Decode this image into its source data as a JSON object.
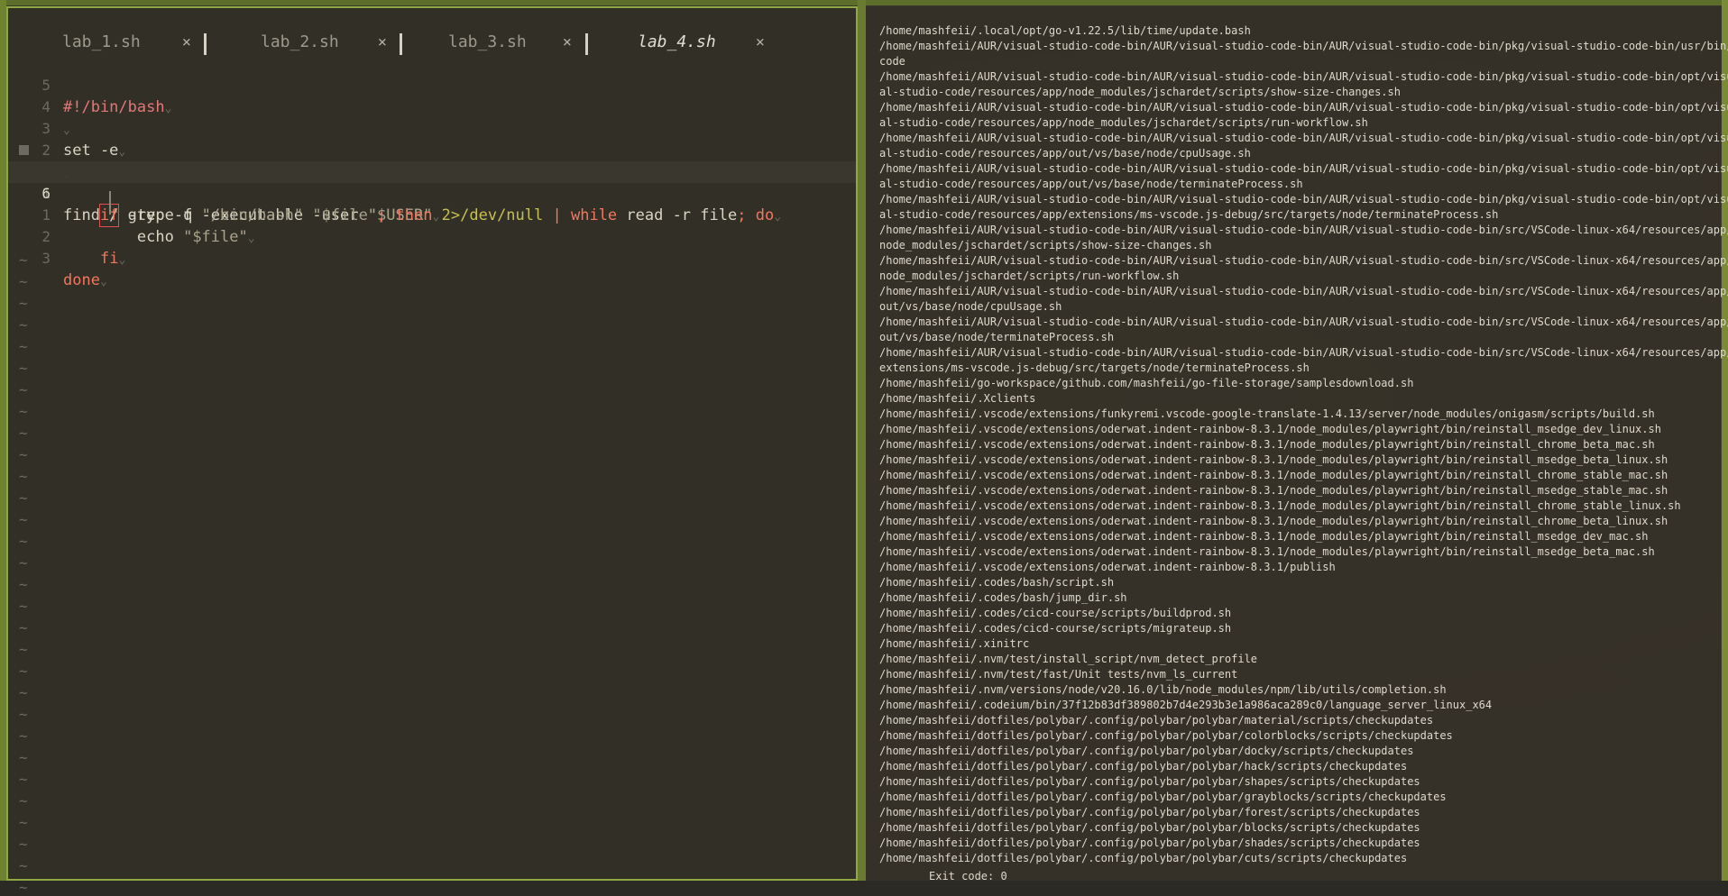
{
  "editor": {
    "tabs": [
      {
        "name": "lab_1.sh",
        "close": "×",
        "active": false
      },
      {
        "name": "lab_2.sh",
        "close": "×",
        "active": false
      },
      {
        "name": "lab_3.sh",
        "close": "×",
        "active": false
      },
      {
        "name": "lab_4.sh",
        "close": "×",
        "active": true
      }
    ],
    "lines": [
      {
        "num": "5",
        "text": "#!/bin/bash"
      },
      {
        "num": "4",
        "text": ""
      },
      {
        "num": "3",
        "text": "set -e"
      },
      {
        "num": "2",
        "text": ""
      },
      {
        "num": "1",
        "text_a": "find / -type f -executable -user ",
        "text_b": "\"$USER\"",
        "text_c": " 2>/dev/null ",
        "text_d": "|",
        "text_e": " while",
        "text_f": " read -r file",
        "text_g": ";",
        "text_h": " do"
      },
      {
        "num": "6",
        "text_a": "if",
        "text_b": " grep -q ",
        "text_c": "\"/bin/bash\"",
        "text_d": " \"$file\"",
        "text_e": ";",
        "text_f": " then"
      },
      {
        "num": "1",
        "text_a": "echo ",
        "text_b": "\"$file\""
      },
      {
        "num": "2",
        "text": "fi"
      },
      {
        "num": "3",
        "text": "done"
      }
    ],
    "tilde": "~",
    "eol_marker": "⌄"
  },
  "terminal": {
    "output": [
      "/home/mashfeii/.local/opt/go-v1.22.5/lib/time/update.bash",
      "/home/mashfeii/AUR/visual-studio-code-bin/AUR/visual-studio-code-bin/AUR/visual-studio-code-bin/pkg/visual-studio-code-bin/usr/bin/",
      "code",
      "/home/mashfeii/AUR/visual-studio-code-bin/AUR/visual-studio-code-bin/AUR/visual-studio-code-bin/pkg/visual-studio-code-bin/opt/visu",
      "al-studio-code/resources/app/node_modules/jschardet/scripts/show-size-changes.sh",
      "/home/mashfeii/AUR/visual-studio-code-bin/AUR/visual-studio-code-bin/AUR/visual-studio-code-bin/pkg/visual-studio-code-bin/opt/visu",
      "al-studio-code/resources/app/node_modules/jschardet/scripts/run-workflow.sh",
      "/home/mashfeii/AUR/visual-studio-code-bin/AUR/visual-studio-code-bin/AUR/visual-studio-code-bin/pkg/visual-studio-code-bin/opt/visu",
      "al-studio-code/resources/app/out/vs/base/node/cpuUsage.sh",
      "/home/mashfeii/AUR/visual-studio-code-bin/AUR/visual-studio-code-bin/AUR/visual-studio-code-bin/pkg/visual-studio-code-bin/opt/visu",
      "al-studio-code/resources/app/out/vs/base/node/terminateProcess.sh",
      "/home/mashfeii/AUR/visual-studio-code-bin/AUR/visual-studio-code-bin/AUR/visual-studio-code-bin/pkg/visual-studio-code-bin/opt/visu",
      "al-studio-code/resources/app/extensions/ms-vscode.js-debug/src/targets/node/terminateProcess.sh",
      "/home/mashfeii/AUR/visual-studio-code-bin/AUR/visual-studio-code-bin/AUR/visual-studio-code-bin/src/VSCode-linux-x64/resources/app/",
      "node_modules/jschardet/scripts/show-size-changes.sh",
      "/home/mashfeii/AUR/visual-studio-code-bin/AUR/visual-studio-code-bin/AUR/visual-studio-code-bin/src/VSCode-linux-x64/resources/app/",
      "node_modules/jschardet/scripts/run-workflow.sh",
      "/home/mashfeii/AUR/visual-studio-code-bin/AUR/visual-studio-code-bin/AUR/visual-studio-code-bin/src/VSCode-linux-x64/resources/app/",
      "out/vs/base/node/cpuUsage.sh",
      "/home/mashfeii/AUR/visual-studio-code-bin/AUR/visual-studio-code-bin/AUR/visual-studio-code-bin/src/VSCode-linux-x64/resources/app/",
      "out/vs/base/node/terminateProcess.sh",
      "/home/mashfeii/AUR/visual-studio-code-bin/AUR/visual-studio-code-bin/AUR/visual-studio-code-bin/src/VSCode-linux-x64/resources/app/",
      "extensions/ms-vscode.js-debug/src/targets/node/terminateProcess.sh",
      "/home/mashfeii/go-workspace/github.com/mashfeii/go-file-storage/samplesdownload.sh",
      "/home/mashfeii/.Xclients",
      "/home/mashfeii/.vscode/extensions/funkyremi.vscode-google-translate-1.4.13/server/node_modules/onigasm/scripts/build.sh",
      "/home/mashfeii/.vscode/extensions/oderwat.indent-rainbow-8.3.1/node_modules/playwright/bin/reinstall_msedge_dev_linux.sh",
      "/home/mashfeii/.vscode/extensions/oderwat.indent-rainbow-8.3.1/node_modules/playwright/bin/reinstall_chrome_beta_mac.sh",
      "/home/mashfeii/.vscode/extensions/oderwat.indent-rainbow-8.3.1/node_modules/playwright/bin/reinstall_msedge_beta_linux.sh",
      "/home/mashfeii/.vscode/extensions/oderwat.indent-rainbow-8.3.1/node_modules/playwright/bin/reinstall_chrome_stable_mac.sh",
      "/home/mashfeii/.vscode/extensions/oderwat.indent-rainbow-8.3.1/node_modules/playwright/bin/reinstall_msedge_stable_mac.sh",
      "/home/mashfeii/.vscode/extensions/oderwat.indent-rainbow-8.3.1/node_modules/playwright/bin/reinstall_chrome_stable_linux.sh",
      "/home/mashfeii/.vscode/extensions/oderwat.indent-rainbow-8.3.1/node_modules/playwright/bin/reinstall_chrome_beta_linux.sh",
      "/home/mashfeii/.vscode/extensions/oderwat.indent-rainbow-8.3.1/node_modules/playwright/bin/reinstall_msedge_dev_mac.sh",
      "/home/mashfeii/.vscode/extensions/oderwat.indent-rainbow-8.3.1/node_modules/playwright/bin/reinstall_msedge_beta_mac.sh",
      "/home/mashfeii/.vscode/extensions/oderwat.indent-rainbow-8.3.1/publish",
      "/home/mashfeii/.codes/bash/script.sh",
      "/home/mashfeii/.codes/bash/jump_dir.sh",
      "/home/mashfeii/.codes/cicd-course/scripts/buildprod.sh",
      "/home/mashfeii/.codes/cicd-course/scripts/migrateup.sh",
      "/home/mashfeii/.xinitrc",
      "/home/mashfeii/.nvm/test/install_script/nvm_detect_profile",
      "/home/mashfeii/.nvm/test/fast/Unit tests/nvm_ls_current",
      "/home/mashfeii/.nvm/versions/node/v20.16.0/lib/node_modules/npm/lib/utils/completion.sh",
      "/home/mashfeii/.codeium/bin/37f12b83df389802b7d4e293b3e1a986aca289c0/language_server_linux_x64",
      "/home/mashfeii/dotfiles/polybar/.config/polybar/polybar/material/scripts/checkupdates",
      "/home/mashfeii/dotfiles/polybar/.config/polybar/polybar/colorblocks/scripts/checkupdates",
      "/home/mashfeii/dotfiles/polybar/.config/polybar/polybar/docky/scripts/checkupdates",
      "/home/mashfeii/dotfiles/polybar/.config/polybar/polybar/hack/scripts/checkupdates",
      "/home/mashfeii/dotfiles/polybar/.config/polybar/polybar/shapes/scripts/checkupdates",
      "/home/mashfeii/dotfiles/polybar/.config/polybar/polybar/grayblocks/scripts/checkupdates",
      "/home/mashfeii/dotfiles/polybar/.config/polybar/polybar/forest/scripts/checkupdates",
      "/home/mashfeii/dotfiles/polybar/.config/polybar/polybar/blocks/scripts/checkupdates",
      "/home/mashfeii/dotfiles/polybar/.config/polybar/polybar/shades/scripts/checkupdates",
      "/home/mashfeii/dotfiles/polybar/.config/polybar/polybar/cuts/scripts/checkupdates"
    ],
    "exit_text": "Exit code: 0"
  }
}
